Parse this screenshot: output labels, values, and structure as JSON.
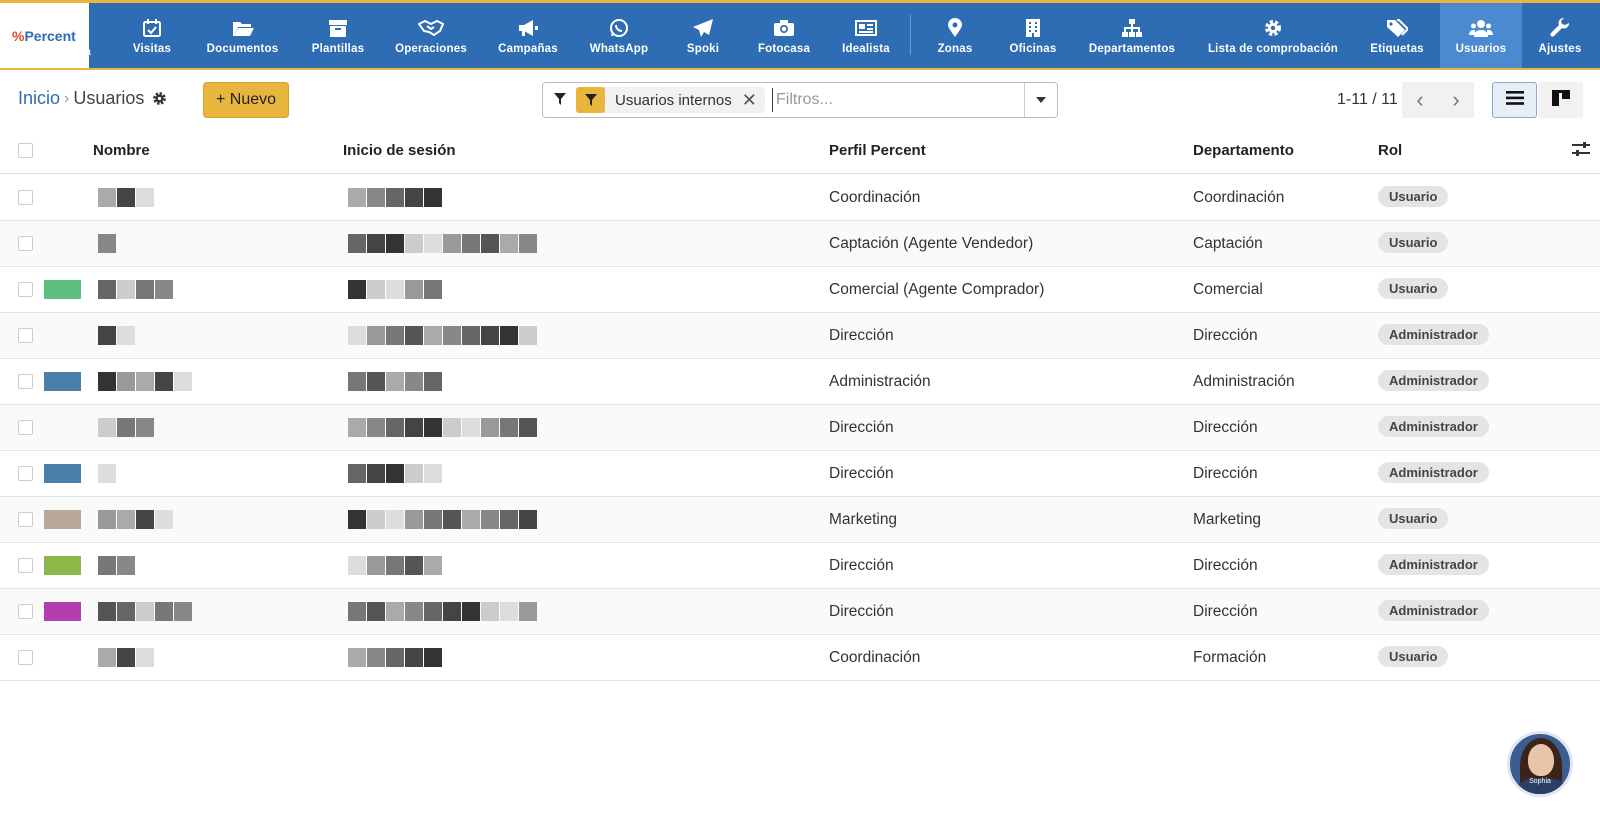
{
  "brand": {
    "logo_text": "Percent",
    "partial_label": "a"
  },
  "nav": [
    {
      "label": "Visitas",
      "icon": "calendar-check-icon"
    },
    {
      "label": "Documentos",
      "icon": "folder-open-icon"
    },
    {
      "label": "Plantillas",
      "icon": "archive-icon"
    },
    {
      "label": "Operaciones",
      "icon": "handshake-icon"
    },
    {
      "label": "Campañas",
      "icon": "megaphone-icon"
    },
    {
      "label": "WhatsApp",
      "icon": "whatsapp-icon"
    },
    {
      "label": "Spoki",
      "icon": "paper-plane-icon"
    },
    {
      "label": "Fotocasa",
      "icon": "camera-icon"
    },
    {
      "label": "Idealista",
      "icon": "newspaper-icon"
    },
    {
      "label": "Zonas",
      "icon": "map-marker-icon"
    },
    {
      "label": "Oficinas",
      "icon": "building-icon"
    },
    {
      "label": "Departamentos",
      "icon": "sitemap-icon"
    },
    {
      "label": "Lista de comprobación",
      "icon": "gear-icon"
    },
    {
      "label": "Etiquetas",
      "icon": "tags-icon"
    },
    {
      "label": "Usuarios",
      "icon": "users-icon",
      "active": true
    },
    {
      "label": "Ajustes",
      "icon": "wrench-icon"
    }
  ],
  "breadcrumb": {
    "home": "Inicio",
    "separator": "›",
    "current": "Usuarios"
  },
  "actions": {
    "new_label": "+ Nuevo"
  },
  "search": {
    "facet_label": "Usuarios internos",
    "facet_remove": "✕",
    "placeholder": "Filtros..."
  },
  "pager": {
    "range": "1-11 / 11",
    "prev": "‹",
    "next": "›"
  },
  "table": {
    "columns": {
      "name": "Nombre",
      "login": "Inicio de sesión",
      "profile": "Perfil Percent",
      "department": "Departamento",
      "role": "Rol"
    },
    "rows": [
      {
        "profile": "Coordinación",
        "department": "Coordinación",
        "role": "Usuario"
      },
      {
        "profile": "Captación (Agente Vendedor)",
        "department": "Captación",
        "role": "Usuario"
      },
      {
        "profile": "Comercial (Agente Comprador)",
        "department": "Comercial",
        "role": "Usuario"
      },
      {
        "profile": "Dirección",
        "department": "Dirección",
        "role": "Administrador"
      },
      {
        "profile": "Administración",
        "department": "Administración",
        "role": "Administrador"
      },
      {
        "profile": "Dirección",
        "department": "Dirección",
        "role": "Administrador"
      },
      {
        "profile": "Dirección",
        "department": "Dirección",
        "role": "Administrador"
      },
      {
        "profile": "Marketing",
        "department": "Marketing",
        "role": "Usuario"
      },
      {
        "profile": "Dirección",
        "department": "Dirección",
        "role": "Administrador"
      },
      {
        "profile": "Dirección",
        "department": "Dirección",
        "role": "Administrador"
      },
      {
        "profile": "Coordinación",
        "department": "Formación",
        "role": "Usuario"
      }
    ]
  },
  "assistant": {
    "name": "Sophia"
  },
  "colors": {
    "topbar": "#2e6db4",
    "accent": "#e8b63f",
    "active_nav": "#4b8ad0"
  }
}
